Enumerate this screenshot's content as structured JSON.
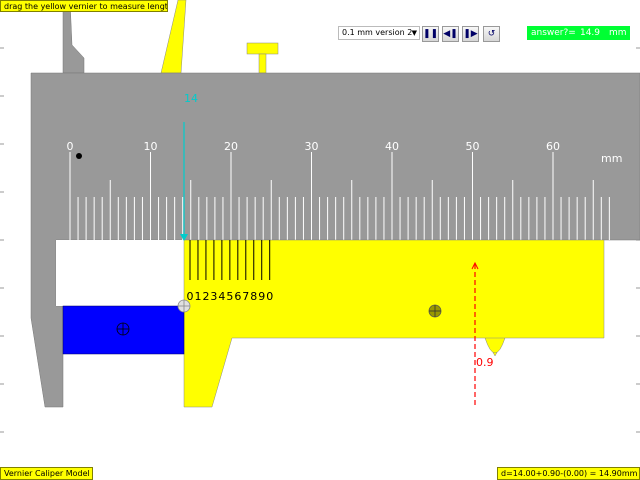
{
  "hint": "drag the yellow vernier to measure length",
  "version_select": {
    "selected": "0.1 mm version 2"
  },
  "controls": {
    "pause": "❚❚",
    "step_back": "◀❚",
    "step_forward": "❚▶",
    "reset": "↺"
  },
  "answer": {
    "label": "answer?=",
    "value": "14.9",
    "unit": "mm"
  },
  "main_scale": {
    "unit": "mm",
    "labels": [
      "0",
      "10",
      "20",
      "30",
      "40",
      "50",
      "60"
    ],
    "max_mm": 67
  },
  "vernier_scale": {
    "labels": [
      "0",
      "1",
      "2",
      "3",
      "4",
      "5",
      "6",
      "7",
      "8",
      "9",
      "0"
    ],
    "divisions": 10,
    "span_mm": 9
  },
  "zero_reading_label": "14",
  "vernier_reading_label": "0.9",
  "measurement": {
    "main_mm": 14.0,
    "vernier_mm": 0.9,
    "zero_error_mm": 0.0,
    "total_mm": 14.9
  },
  "model_title": "Vernier Caliper Model",
  "formula": "d=14.00+0.90-(0.00) = 14.90mm",
  "colors": {
    "body": "#999999",
    "vernier": "#ffff00",
    "object": "#0000ff",
    "zero_marker": "#00cccc",
    "reading_marker": "#ff0000"
  }
}
